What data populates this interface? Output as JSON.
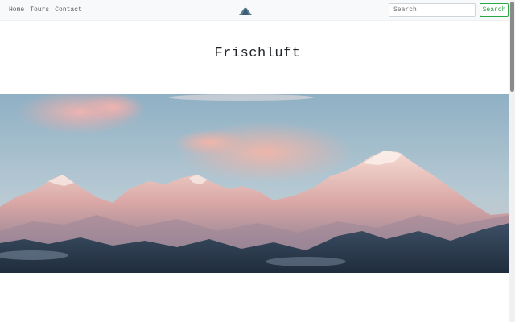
{
  "navbar": {
    "links": [
      {
        "label": "Home"
      },
      {
        "label": "Tours"
      },
      {
        "label": "Contact"
      }
    ],
    "brand_icon": "mountain-logo-icon",
    "search": {
      "placeholder": "Search",
      "button_label": "Search"
    }
  },
  "main": {
    "title": "Frischluft",
    "hero_image": "mountain-panorama-image"
  },
  "colors": {
    "navbar_bg": "#f8f9fa",
    "accent_green": "#28a745",
    "text": "#212529"
  }
}
